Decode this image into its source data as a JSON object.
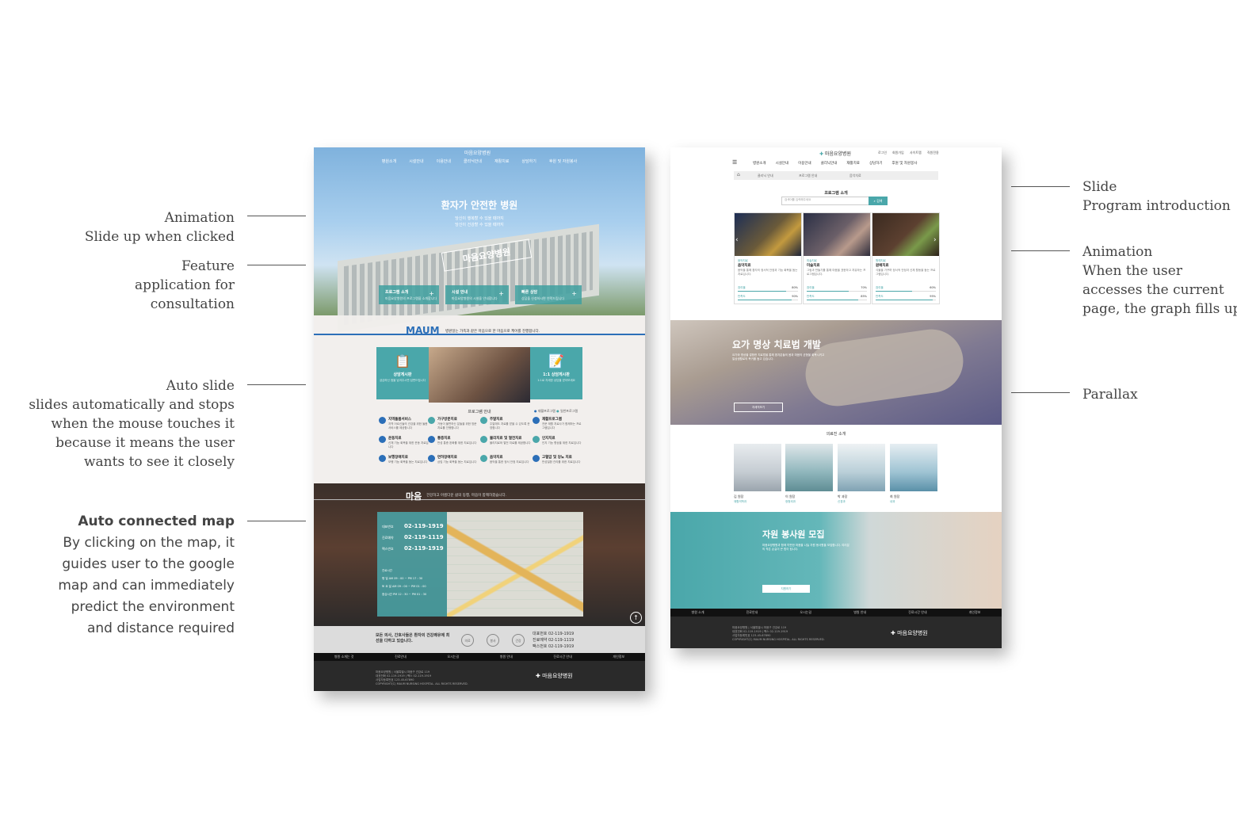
{
  "annotations_left": {
    "animation": {
      "title": "Animation",
      "desc": "Slide up when clicked"
    },
    "feature": {
      "line1": "Feature",
      "line2": "application for",
      "line3": "consultation"
    },
    "auto_slide": {
      "title": "Auto slide",
      "line1": "slides automatically and stops",
      "line2": "when the mouse touches it",
      "line3": "because it means the user",
      "line4": "wants to see it closely"
    },
    "map": {
      "title": "Auto connected map",
      "line1": "By clicking on the map, it",
      "line2": "guides user to the google",
      "line3": "map and can immediately",
      "line4": "predict the environment",
      "line5": "and distance required"
    }
  },
  "annotations_right": {
    "slide": {
      "title": "Slide",
      "desc": "Program introduction"
    },
    "animation": {
      "title": "Animation",
      "line1": "When the user",
      "line2": "accesses the current",
      "line3": "page, the graph fills up."
    },
    "parallax": {
      "title": "Parallax"
    }
  },
  "left_mock": {
    "logo": "마음요양병원",
    "nav": [
      "병원소개",
      "시설안내",
      "이용안내",
      "클리닉안내",
      "재활치료",
      "상담하기",
      "후원 및 자원봉사"
    ],
    "hero_title": "환자가 안전한 병원",
    "hero_sub1": "당신이 행복할 수 있을 때까지",
    "hero_sub2": "당신이 건강할 수 있을 때까지",
    "sign": "마음요양병원",
    "quick": [
      {
        "title": "프로그램 소개",
        "desc": "마음요양병원의 프로그램을 소개합니다"
      },
      {
        "title": "시설 안내",
        "desc": "마음요양병원의 시설을 안내합니다"
      },
      {
        "title": "빠른 상담",
        "desc": "상담을 신청하시면 연락드립니다"
      }
    ],
    "maum_head": "MAUM",
    "maum_desc": "병원일는 가족과 같은 마음으로 한 마음으로 케어를 진행합니다.",
    "card_left": {
      "title": "상담게시판",
      "desc": "궁금하신 점을 남겨주시면 답변드립니다"
    },
    "card_right": {
      "title": "1:1 상담게시판",
      "desc": "1:1로 자세한 상담을 받아보세요"
    },
    "program_title": "프로그램 안내",
    "legend": [
      "재활프로그램",
      "일반프로그램"
    ],
    "programs": [
      {
        "name": "지역돌봄서비스",
        "desc": "지역 어르신들의 건강을 위한 돌봄 서비스를 제공합니다"
      },
      {
        "name": "가구방문치료",
        "desc": "거동이 불편하신 분들을 위한 방문 치료를 진행합니다"
      },
      {
        "name": "주말치료",
        "desc": "주말에도 치료를 받을 수 있도록 운영합니다"
      },
      {
        "name": "재활프로그램",
        "desc": "전문 재활 치료사가 함께하는 프로그램입니다"
      },
      {
        "name": "운동치료",
        "desc": "신체 기능 회복을 위한 운동 치료입니다"
      },
      {
        "name": "통증치료",
        "desc": "만성 통증 완화를 위한 치료입니다"
      },
      {
        "name": "물리치료 및 열전치료",
        "desc": "물리치료와 열전 치료를 제공합니다"
      },
      {
        "name": "인지치료",
        "desc": "인지 기능 향상을 위한 치료입니다"
      },
      {
        "name": "보행장애치료",
        "desc": "보행 기능 회복을 돕는 치료입니다"
      },
      {
        "name": "연하장애치료",
        "desc": "삼킴 기능 회복을 돕는 치료입니다"
      },
      {
        "name": "음악치료",
        "desc": "음악을 통한 정서 안정 치료입니다"
      },
      {
        "name": "고혈압 및 당뇨 치료",
        "desc": "만성질환 관리를 위한 치료입니다"
      }
    ],
    "map_head": "마음",
    "map_desc": "건강하고 아름다운 삶의 동행, 마음이 함께하겠습니다.",
    "contacts": [
      {
        "label": "대표번호",
        "num": "02-119-1919"
      },
      {
        "label": "진료예약",
        "num": "02-119-1119"
      },
      {
        "label": "팩스번호",
        "num": "02-119-1919"
      }
    ],
    "hours_title": "진료시간",
    "hours": [
      "평 일  AM 09 : 00 ~ PM 17 : 30",
      "토 요 일  AM 09 : 00 ~ PM 01 : 00",
      "점심시간  PM 12 : 30 ~ PM 01 : 30"
    ],
    "contact_msg": "모든 의사, 간호사들은 환자의 건강쾌유에 최선을 다하고 있습니다.",
    "contact_icons": [
      "의료",
      "봉사",
      "건강"
    ],
    "contact_phones": [
      "대표번호 02-119-1919",
      "진료예약 02-119-1119",
      "팩스번호 02-119-1919"
    ],
    "footer_nav": [
      "병원 소개는 것",
      "진료안내",
      "오시는길",
      "병원 안내",
      "진료시간 안내",
      "개인정보"
    ],
    "footer_addr": [
      "마음요양병원 | 서울특별시 마음구 건강로 119",
      "대표전화 02-119-1919 | 팩스 02-119-1919",
      "사업자등록번호 123-45-67890",
      "COPYRIGHT(C) MAUM NURSING HOSPITAL. ALL RIGHTS RESERVED."
    ],
    "footer_logo": "마음요양병원"
  },
  "right_mock": {
    "logo": "마음요양병원",
    "util": [
      "로그인",
      "회원가입",
      "사이트맵",
      "직원전용"
    ],
    "nav": [
      "병원소개",
      "시설안내",
      "이용안내",
      "클리닉안내",
      "재활치료",
      "상담하기",
      "후원 및 자원봉사"
    ],
    "breadcrumb": [
      "홈",
      "클리닉 안내",
      "프로그램 안내",
      "음악치료"
    ],
    "section_title": "프로그램 소개",
    "search_placeholder": "검색어를 입력해주세요",
    "search_btn": "검색",
    "cards": [
      {
        "cat": "음악치료",
        "name": "음악치료",
        "desc": "음악을 통해 환자의 정서적 안정과 기능 회복을 돕는 치료입니다.",
        "label1": "참여율",
        "pct1": "80%",
        "fill1": 0.8,
        "label2": "만족도",
        "pct2": "90%",
        "fill2": 0.9
      },
      {
        "cat": "미술치료",
        "name": "미술치료",
        "desc": "그림과 만들기를 통해 마음을 표현하고 치유하는 프로그램입니다.",
        "label1": "참여율",
        "pct1": "70%",
        "fill1": 0.7,
        "label2": "만족도",
        "pct2": "85%",
        "fill2": 0.85
      },
      {
        "cat": "원예치료",
        "name": "원예치료",
        "desc": "식물을 가꾸며 정서적 안정과 신체 활동을 돕는 프로그램입니다.",
        "label1": "참여율",
        "pct1": "60%",
        "fill1": 0.6,
        "label2": "만족도",
        "pct2": "95%",
        "fill2": 0.95
      }
    ],
    "yoga_title": "요가 명상 치료법 개발",
    "yoga_text": "요가와 명상을 결합한 치료법을 통해 환자분들의 몸과 마음의 균형을 회복시키고 일상생활로의 복귀를 돕고 있습니다.",
    "yoga_btn": "자세히보기",
    "staff_title": "의료진 소개",
    "staff": [
      {
        "name": "김 원장",
        "dept": "재활의학과"
      },
      {
        "name": "이 원장",
        "dept": "정형외과"
      },
      {
        "name": "박 과장",
        "dept": "신경과"
      },
      {
        "name": "최 원장",
        "dept": "내과"
      }
    ],
    "vol_title": "자원 봉사원 모집",
    "vol_text": "마음요양병원과 함께 따뜻한 마음을 나눌 자원 봉사원을 모집합니다. 여러분의 작은 손길이 큰 힘이 됩니다.",
    "vol_btn": "지원하기",
    "footer_nav": [
      "병원 소개",
      "진료안내",
      "오시는길",
      "병원 안내",
      "진료시간 안내",
      "개인정보"
    ],
    "footer_addr": [
      "마음요양병원 | 서울특별시 마음구 건강로 119",
      "대표전화 02-119-1919 | 팩스 02-119-1919",
      "사업자등록번호 123-45-67890",
      "COPYRIGHT(C) MAUM NURSING HOSPITAL. ALL RIGHTS RESERVED."
    ],
    "footer_logo": "마음요양병원"
  }
}
